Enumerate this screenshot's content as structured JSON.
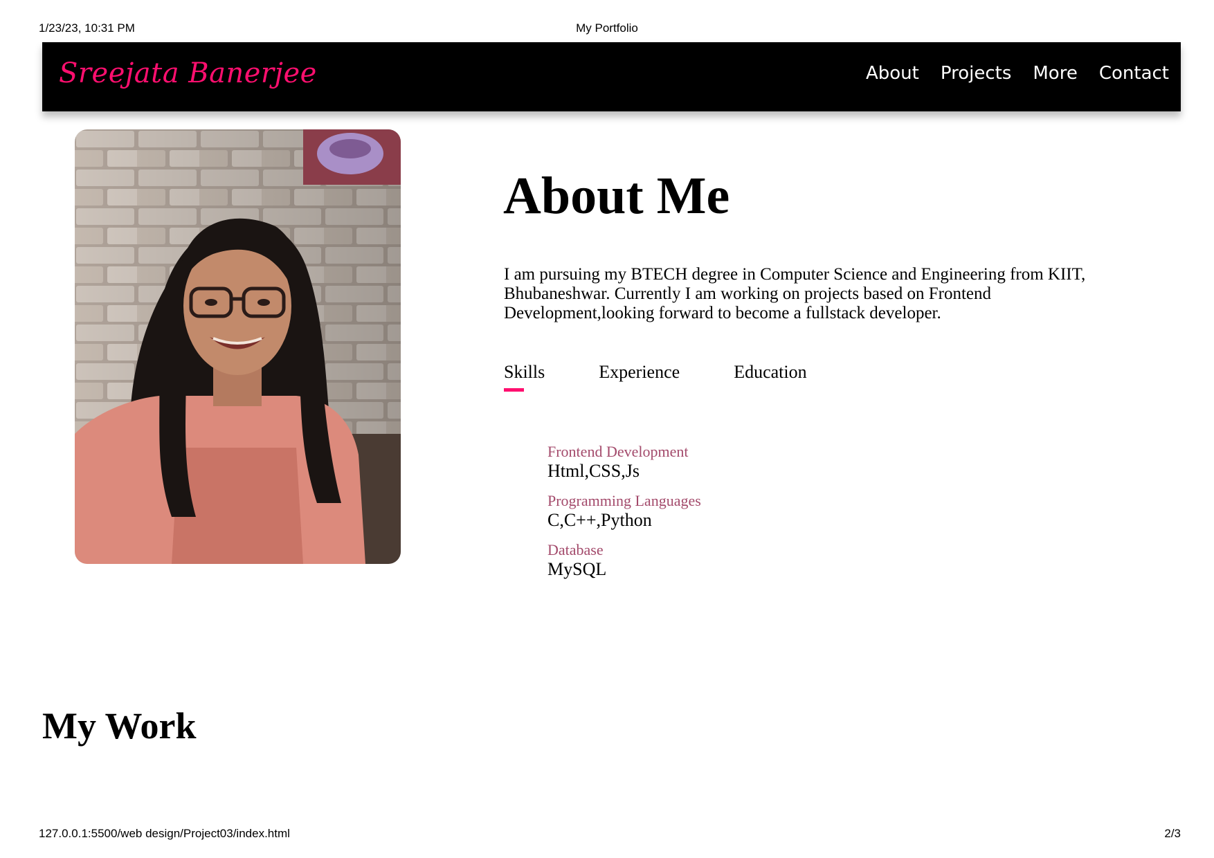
{
  "print_header": {
    "datetime": "1/23/23, 10:31 PM",
    "title": "My Portfolio"
  },
  "navbar": {
    "brand": "Sreejata Banerjee",
    "brand_color": "#ff0f6f",
    "links": [
      "About",
      "Projects",
      "More",
      "Contact"
    ]
  },
  "about": {
    "title": "About Me",
    "text": "I am pursuing my BTECH degree in Computer Science and Engineering from KIIT, Bhubaneshwar. Currently I am working on projects based on Frontend Development,looking forward to become a fullstack developer.",
    "tabs": [
      "Skills",
      "Experience",
      "Education"
    ],
    "active_tab": "Skills",
    "skills": [
      {
        "label": "Frontend Development",
        "value": "Html,CSS,Js"
      },
      {
        "label": "Programming Languages",
        "value": "C,C++,Python"
      },
      {
        "label": "Database",
        "value": "MySQL"
      }
    ]
  },
  "work": {
    "title": "My Work"
  },
  "print_footer": {
    "url": "127.0.0.1:5500/web design/Project03/index.html",
    "page": "2/3"
  }
}
